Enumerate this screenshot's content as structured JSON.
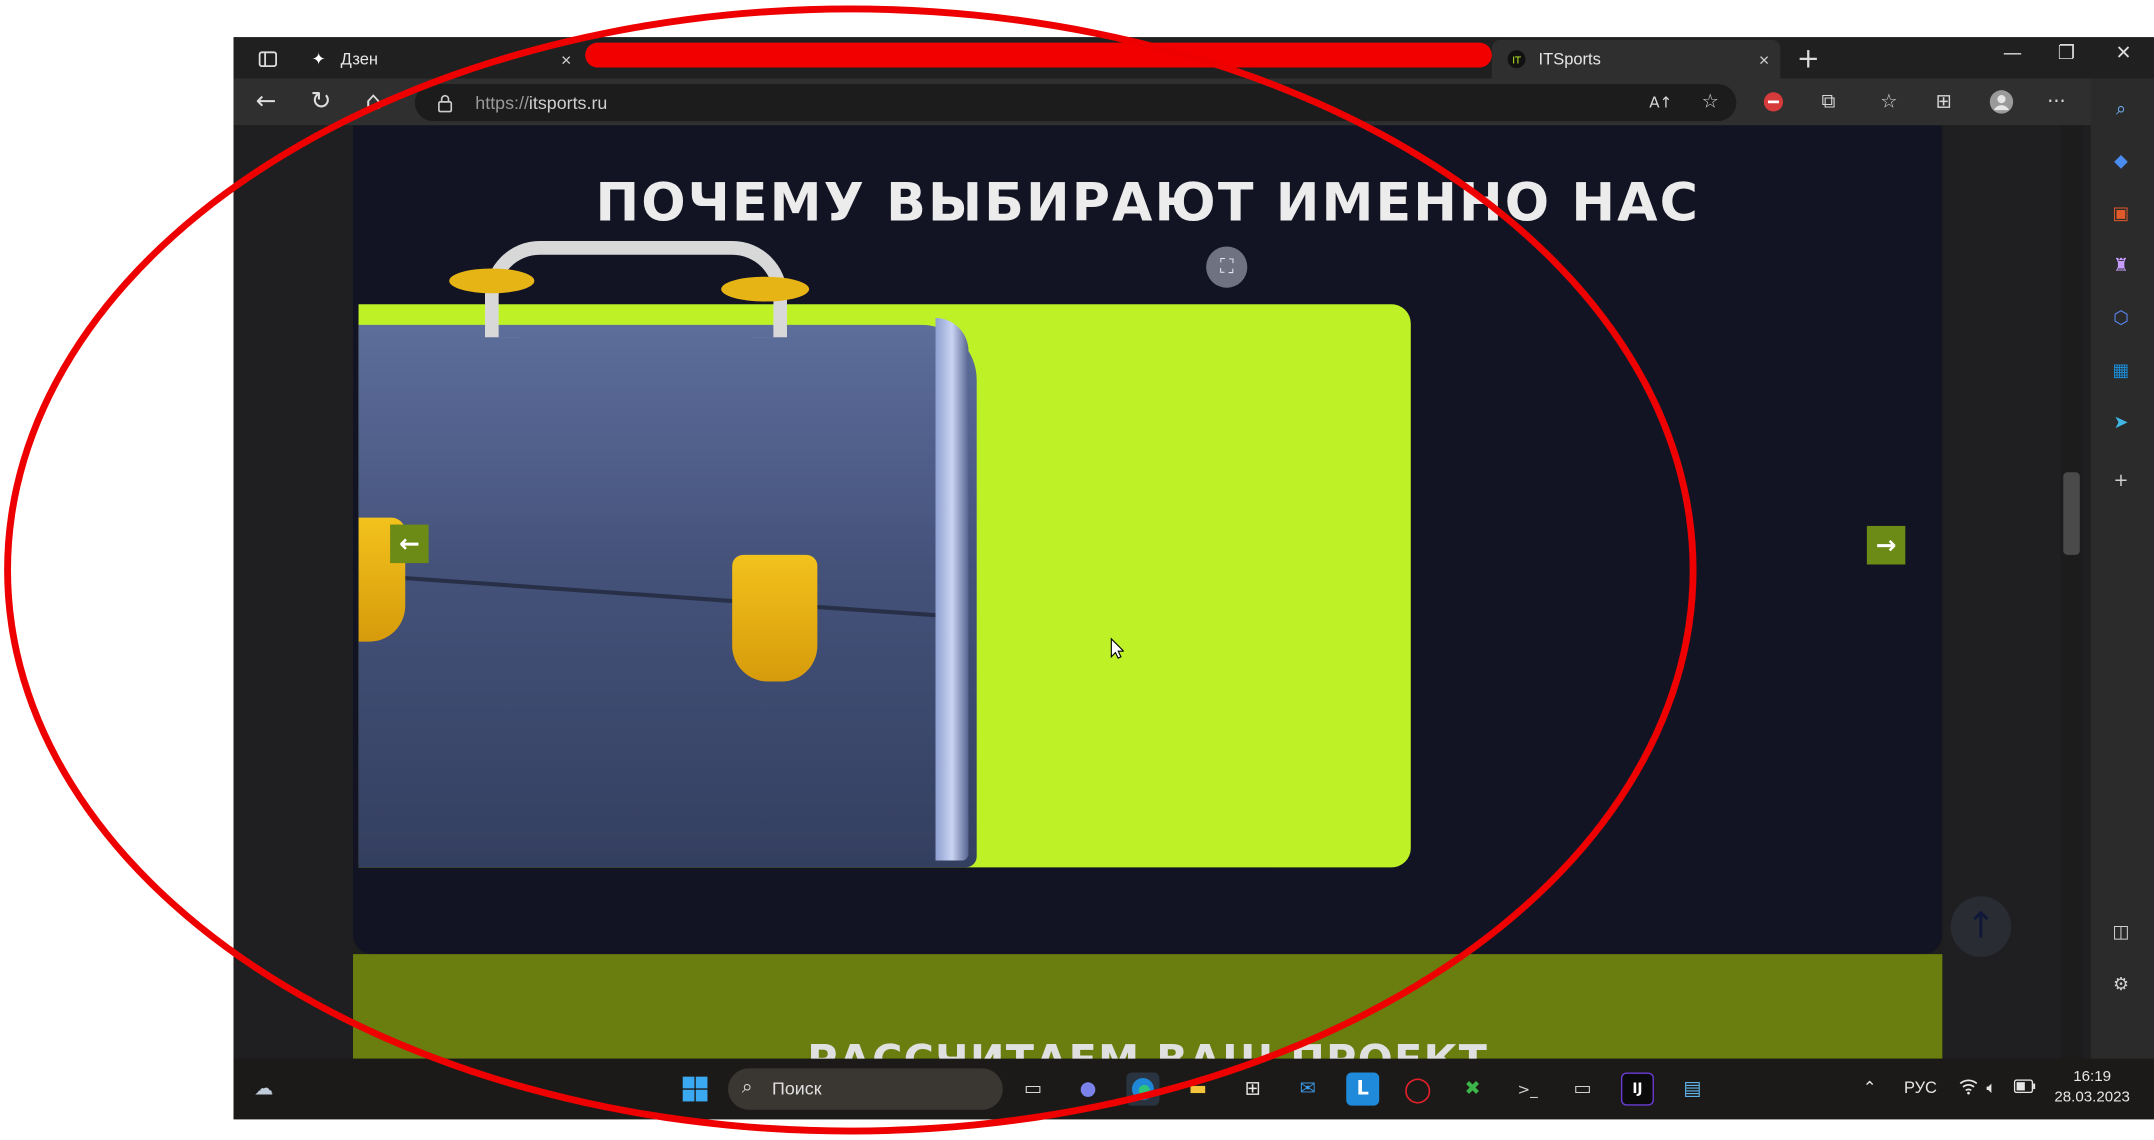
{
  "tabs": [
    {
      "title": "Дзен",
      "close": "×"
    },
    {
      "title": "ITSports",
      "close": "×"
    }
  ],
  "new_tab": "+",
  "address": {
    "scheme": "https://",
    "host": "itsports.ru"
  },
  "page": {
    "heading": "ПОЧЕМУ ВЫБИРАЮТ ИМЕННО НАС",
    "partial_heading": "РАССЧИТАЕМ ВАШ ПРОЕКТ",
    "prev_arrow": "←",
    "next_arrow": "→",
    "scroll_top_arrow": "↑"
  },
  "taskbar": {
    "search_placeholder": "Поиск",
    "language": "РУС",
    "time": "16:19",
    "date": "28.03.2023"
  },
  "colors": {
    "page_bg": "#121424",
    "accent_green": "#bef227",
    "olive_section": "#6a7d0f",
    "annotation_red": "#ee0000"
  },
  "icons": [
    "tab-actions-icon",
    "sparkle-icon",
    "itsports-logo-icon",
    "back-icon",
    "reload-icon",
    "home-icon",
    "lock-icon",
    "read-aloud-icon",
    "favorite-add-icon",
    "adblock-icon",
    "extensions-icon",
    "favorites-icon",
    "collections-icon",
    "profile-icon",
    "more-icon",
    "bing-icon",
    "search-icon",
    "tag-icon",
    "briefcase-icon",
    "games-icon",
    "copilot-icon",
    "outlook-icon",
    "send-icon",
    "add-icon",
    "split-icon",
    "settings-icon",
    "scan-icon",
    "arrow-left-icon",
    "arrow-right-icon",
    "arrow-up-icon",
    "weather-icon",
    "windows-start-icon",
    "task-view-icon",
    "teams-icon",
    "edge-icon",
    "explorer-icon",
    "store-icon",
    "mail-icon",
    "launcher-icon",
    "opera-icon",
    "xbox-icon",
    "terminal-icon",
    "console-icon",
    "intellij-icon",
    "notepad-icon",
    "chevron-up-icon",
    "wifi-icon",
    "volume-icon",
    "battery-icon"
  ]
}
